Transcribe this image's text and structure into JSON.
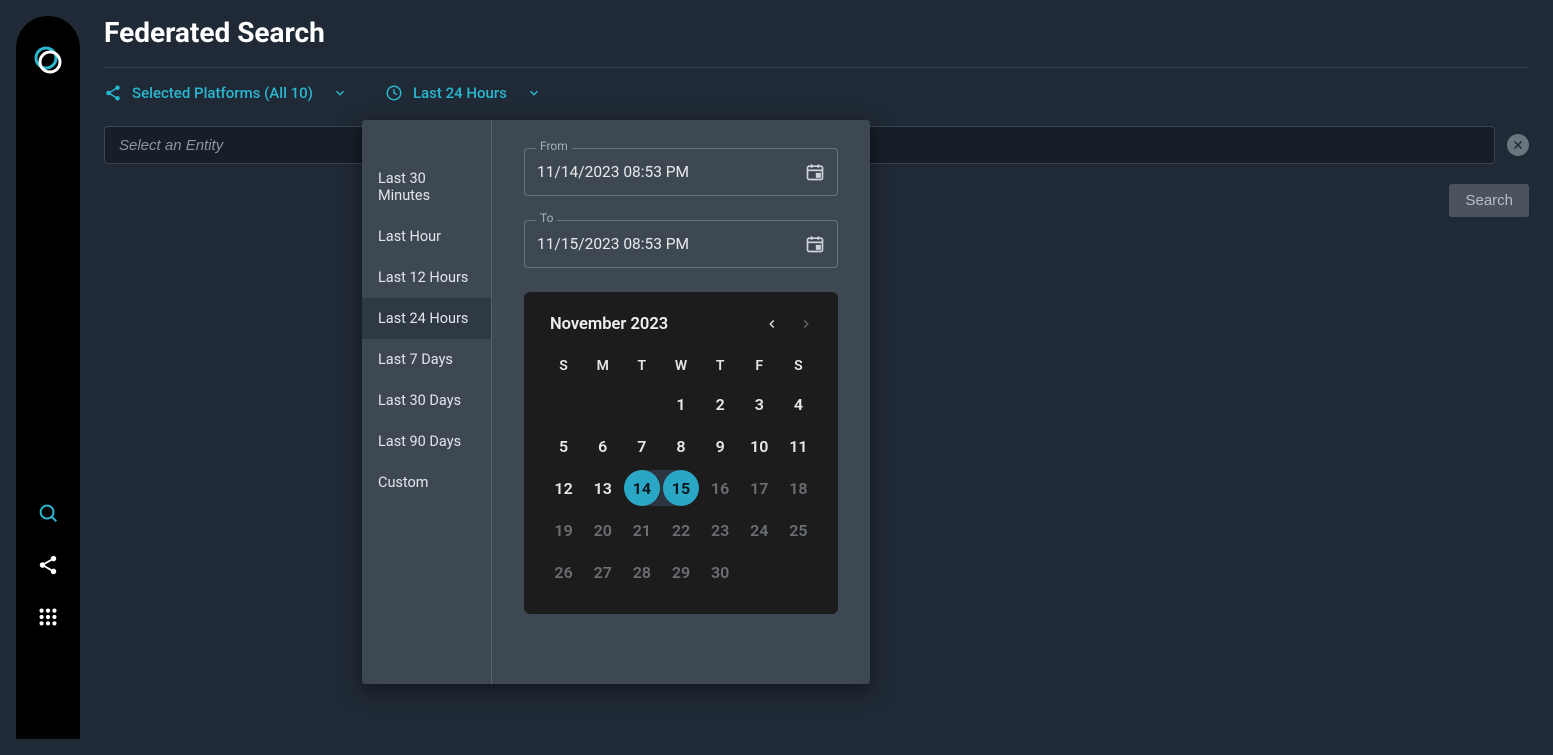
{
  "page": {
    "title": "Federated Search"
  },
  "filters": {
    "platforms_label": "Selected Platforms (All 10)",
    "time_label": "Last 24 Hours"
  },
  "search": {
    "placeholder": "Select an Entity",
    "button_label": "Search"
  },
  "time_panel": {
    "presets": [
      "Last 30 Minutes",
      "Last Hour",
      "Last 12 Hours",
      "Last 24 Hours",
      "Last 7 Days",
      "Last 30 Days",
      "Last 90 Days",
      "Custom"
    ],
    "active_preset": "Last 24 Hours",
    "from": {
      "label": "From",
      "value": "11/14/2023 08:53 PM"
    },
    "to": {
      "label": "To",
      "value": "11/15/2023 08:53 PM"
    },
    "calendar": {
      "month_label": "November 2023",
      "dow": [
        "S",
        "M",
        "T",
        "W",
        "T",
        "F",
        "S"
      ],
      "weeks": [
        [
          null,
          null,
          null,
          1,
          2,
          3,
          4
        ],
        [
          5,
          6,
          7,
          8,
          9,
          10,
          11
        ],
        [
          12,
          13,
          14,
          15,
          16,
          17,
          18
        ],
        [
          19,
          20,
          21,
          22,
          23,
          24,
          25
        ],
        [
          26,
          27,
          28,
          29,
          30,
          null,
          null
        ]
      ],
      "selected_start": 14,
      "selected_end": 15,
      "dim_from": 16
    }
  },
  "colors": {
    "accent": "#29b6cf"
  }
}
